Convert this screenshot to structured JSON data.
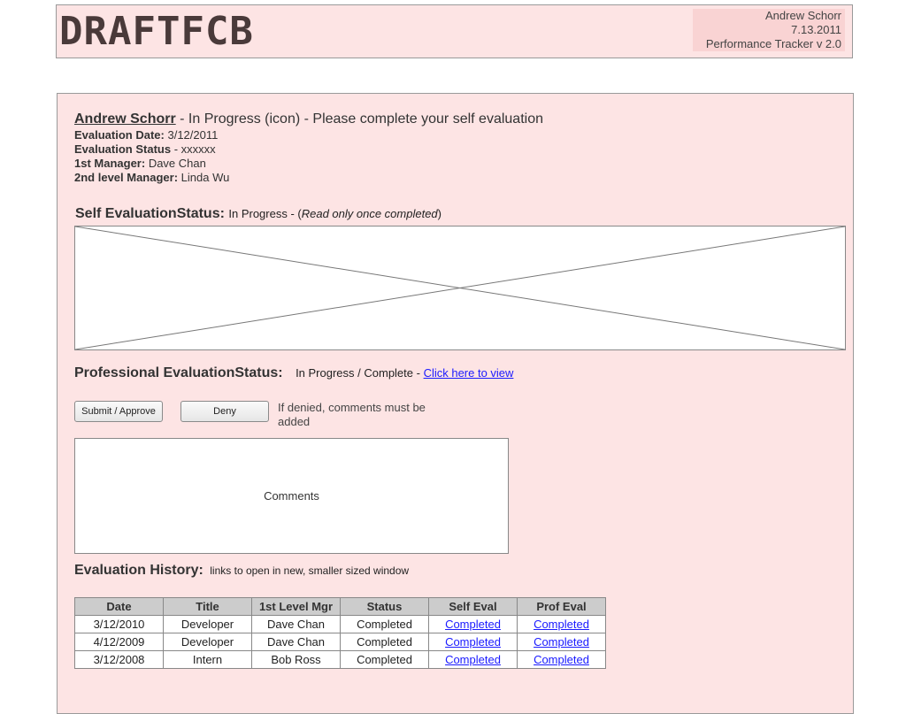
{
  "header": {
    "logo": "DRAFTFCB",
    "user_name": "Andrew Schorr",
    "date": "7.13.2011",
    "app_version": "Performance Tracker v 2.0"
  },
  "employee": {
    "name": "Andrew Schorr",
    "status_line": " - In Progress (icon) - Please complete your self evaluation",
    "eval_date_label": "Evaluation Date:",
    "eval_date_value": " 3/12/2011",
    "eval_status_label": "Evaluation Status",
    "eval_status_value": " - xxxxxx",
    "manager1_label": "1st Manager:",
    "manager1_value": " Dave Chan",
    "manager2_label": "2nd level Manager:",
    "manager2_value": " Linda Wu"
  },
  "self_eval": {
    "label": "Self EvaluationStatus:",
    "status": "In Progress - (",
    "note": "Read only once completed",
    "close": ")"
  },
  "prof_eval": {
    "label": "Professional EvaluationStatus:",
    "status": "In Progress / Complete - ",
    "link": "Click here to view"
  },
  "actions": {
    "submit_label": "Submit / Approve",
    "deny_label": "Deny",
    "deny_note": "If denied, comments must be added"
  },
  "comments": {
    "placeholder": "Comments"
  },
  "history": {
    "title": "Evaluation History:",
    "note": "links to open in new, smaller sized window",
    "columns": [
      "Date",
      "Title",
      "1st Level Mgr",
      "Status",
      "Self Eval",
      "Prof Eval"
    ],
    "rows": [
      [
        "3/12/2010",
        "Developer",
        "Dave Chan",
        "Completed",
        "Completed",
        "Completed"
      ],
      [
        "4/12/2009",
        "Developer",
        "Dave Chan",
        "Completed",
        "Completed",
        "Completed"
      ],
      [
        "3/12/2008",
        "Intern",
        "Bob Ross",
        "Completed",
        "Completed",
        "Completed"
      ]
    ]
  }
}
